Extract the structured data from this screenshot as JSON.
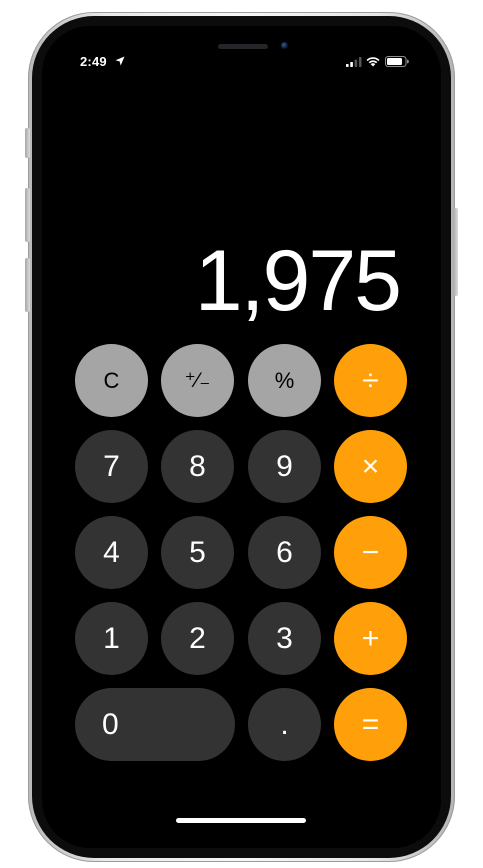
{
  "status_bar": {
    "time": "2:49",
    "icons": [
      "location-arrow-icon",
      "cellular-signal-icon",
      "wifi-icon",
      "battery-icon"
    ]
  },
  "display": {
    "value": "1,975"
  },
  "keys": {
    "clear": "C",
    "plus_minus": "⁺∕₋",
    "percent": "%",
    "divide": "÷",
    "seven": "7",
    "eight": "8",
    "nine": "9",
    "multiply": "×",
    "four": "4",
    "five": "5",
    "six": "6",
    "minus": "−",
    "one": "1",
    "two": "2",
    "three": "3",
    "plus": "+",
    "zero": "0",
    "decimal": ".",
    "equals": "="
  },
  "colors": {
    "number_key": "#333333",
    "function_key": "#a5a5a5",
    "operator_key": "#ff9f0a",
    "background": "#000000"
  }
}
